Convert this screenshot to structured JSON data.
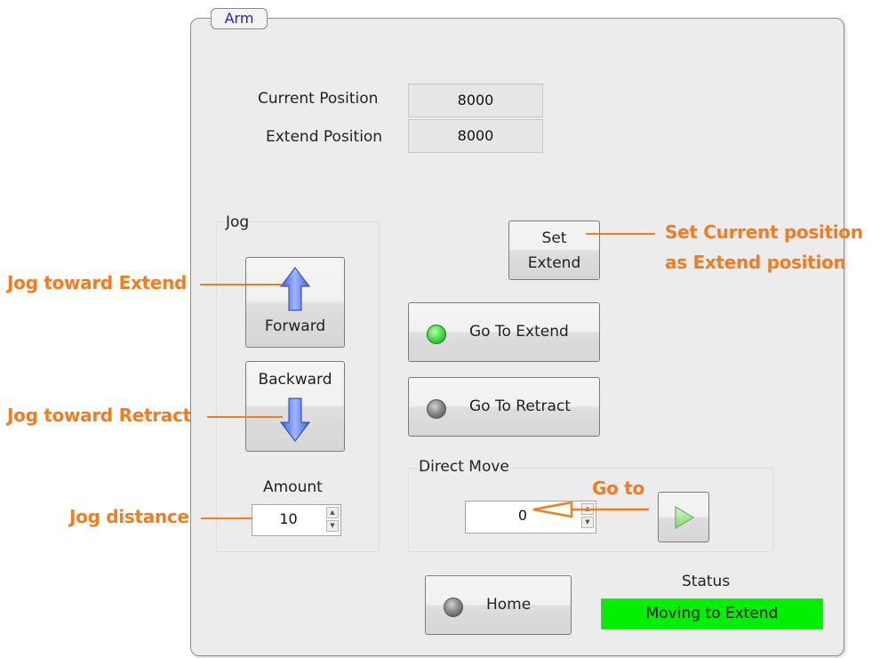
{
  "panel": {
    "title": "Arm"
  },
  "positions": {
    "current_label": "Current Position",
    "current_value": "8000",
    "extend_label": "Extend Position",
    "extend_value": "8000"
  },
  "jog": {
    "group_label": "Jog",
    "forward_label": "Forward",
    "backward_label": "Backward",
    "amount_label": "Amount",
    "amount_value": "10"
  },
  "buttons": {
    "set_extend_line1": "Set",
    "set_extend_line2": "Extend",
    "go_to_extend": "Go To Extend",
    "go_to_retract": "Go To Retract",
    "home": "Home"
  },
  "direct_move": {
    "group_label": "Direct Move",
    "value": "0"
  },
  "status": {
    "label": "Status",
    "value": "Moving to Extend"
  },
  "annotations": {
    "jog_extend": "Jog toward Extend",
    "jog_retract": "Jog toward Retract",
    "jog_distance": "Jog distance",
    "set_current_line1": "Set Current position",
    "set_current_line2": "as Extend position",
    "go_to": "Go to"
  },
  "colors": {
    "annotation": "#f47c1f",
    "status_ok": "#00f000",
    "led_on": "#4fe04a",
    "led_off": "#8b8b8b"
  },
  "icons": [
    "arrow-up-icon",
    "arrow-down-icon",
    "play-icon",
    "led-indicator-icon"
  ]
}
